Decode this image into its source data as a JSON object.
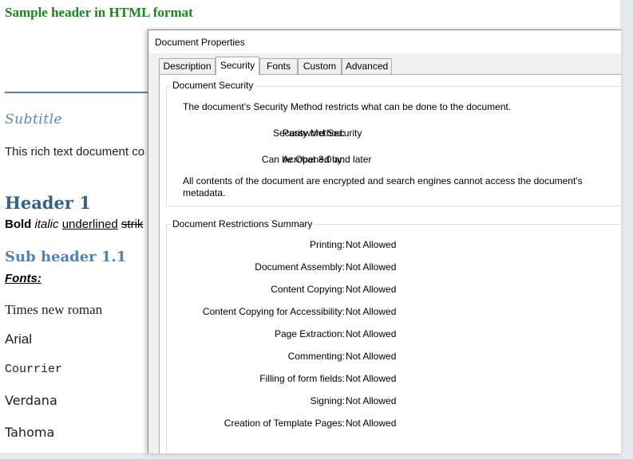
{
  "document": {
    "title": "Sample header in HTML format",
    "subtitle": "Subtitle",
    "paragraph": "This rich text document co",
    "header1": "Header 1",
    "styles": {
      "bold": "Bold",
      "italic": "italic",
      "underlined": "underlined",
      "strike": "strik"
    },
    "subheader": "Sub header 1.1",
    "fonts_label": "Fonts:",
    "font_samples": [
      "Times new roman",
      "Arial",
      "Courrier",
      "Verdana",
      "Tahoma"
    ]
  },
  "dialog": {
    "title": "Document Properties",
    "tabs": [
      {
        "label": "Description",
        "active": false
      },
      {
        "label": "Security",
        "active": true
      },
      {
        "label": "Fonts",
        "active": false
      },
      {
        "label": "Custom",
        "active": false
      },
      {
        "label": "Advanced",
        "active": false
      }
    ],
    "security_group": {
      "label": "Document Security",
      "intro": "The document's Security Method restricts what can be done to the document.",
      "method_label": "Security Method:",
      "method_value": "Password Security",
      "opened_label": "Can be Opened by:",
      "opened_value": "Acrobat 3.0 and later",
      "note": "All contents of the document are encrypted and search engines cannot access the document's metadata."
    },
    "restrictions_group": {
      "label": "Document Restrictions Summary",
      "rows": [
        {
          "label": "Printing:",
          "value": "Not Allowed"
        },
        {
          "label": "Document Assembly:",
          "value": "Not Allowed"
        },
        {
          "label": "Content Copying:",
          "value": "Not Allowed"
        },
        {
          "label": "Content Copying for Accessibility:",
          "value": "Not Allowed"
        },
        {
          "label": "Page Extraction:",
          "value": "Not Allowed"
        },
        {
          "label": "Commenting:",
          "value": "Not Allowed"
        },
        {
          "label": "Filling of form fields:",
          "value": "Not Allowed"
        },
        {
          "label": "Signing:",
          "value": "Not Allowed"
        },
        {
          "label": "Creation of Template Pages:",
          "value": "Not Allowed"
        }
      ]
    }
  },
  "colors": {
    "title_green": "#178a17",
    "heading_blue": "#365f91",
    "subheading_blue": "#4f81bd",
    "dialog_bg": "#f0f0f0"
  }
}
